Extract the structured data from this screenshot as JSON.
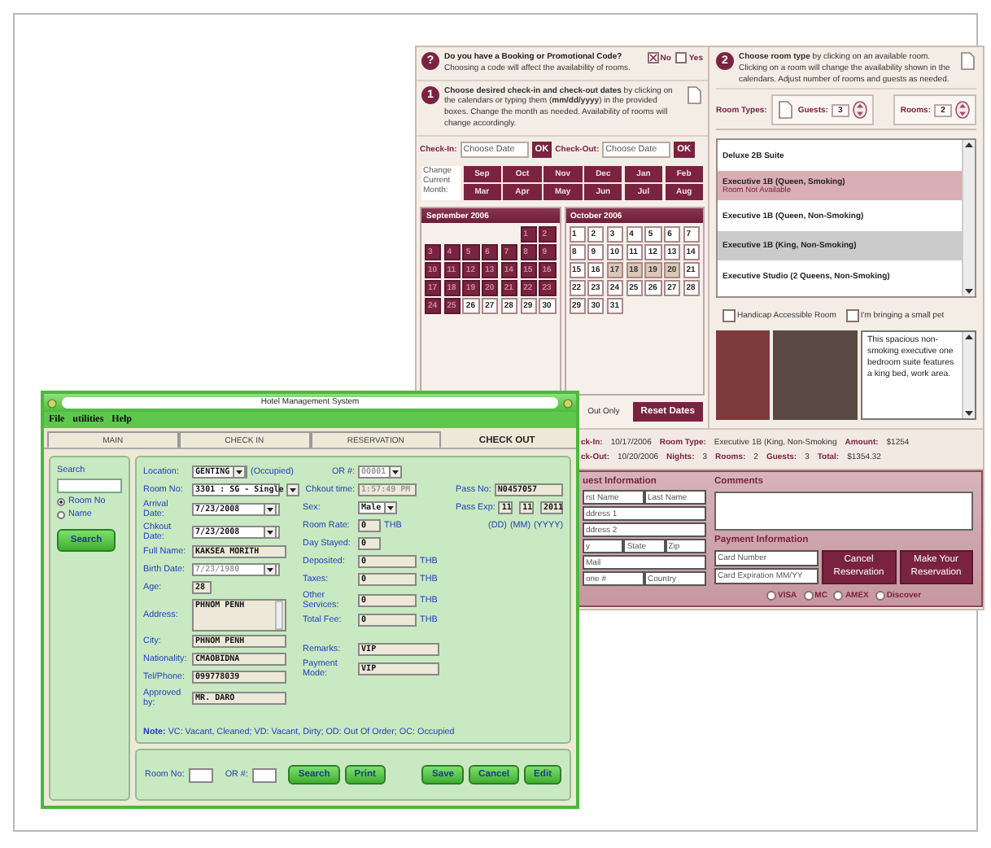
{
  "booking_window": {
    "promo": {
      "badge": "?",
      "title": "Do you have a Booking or Promotional Code?",
      "hint": "Choosing a code will affect the availability of rooms.",
      "options": [
        {
          "label": "No",
          "checked": true
        },
        {
          "label": "Yes",
          "checked": false
        }
      ]
    },
    "dates": {
      "badge": "1",
      "text": "**Choose desired check-in and check-out dates** by clicking on the calendars or typing them (**mm/dd/yyyy**) in the provided boxes. Change the month as needed. Availability of rooms will change accordingly.",
      "fields": [
        {
          "label": "Check-In:",
          "placeholder": "Choose Date",
          "button": "OK"
        },
        {
          "label": "Check-Out:",
          "placeholder": "Choose Date",
          "button": "OK"
        }
      ],
      "month_label": "Change Current Month:",
      "months": [
        "Sep",
        "Oct",
        "Nov",
        "Dec",
        "Jan",
        "Feb",
        "Mar",
        "Apr",
        "May",
        "Jun",
        "Jul",
        "Aug"
      ],
      "calendars": [
        {
          "title": "September 2006",
          "days": [
            {
              "kind": "empty"
            },
            {
              "kind": "empty"
            },
            {
              "kind": "empty"
            },
            {
              "kind": "empty"
            },
            {
              "kind": "empty"
            },
            {
              "day": "1",
              "kind": "blocked"
            },
            {
              "day": "2",
              "kind": "blocked"
            },
            {
              "day": "3",
              "kind": "blocked"
            },
            {
              "day": "4",
              "kind": "blocked"
            },
            {
              "day": "5",
              "kind": "blocked"
            },
            {
              "day": "6",
              "kind": "blocked"
            },
            {
              "day": "7",
              "kind": "blocked"
            },
            {
              "day": "8",
              "kind": "blocked"
            },
            {
              "day": "9",
              "kind": "blocked"
            },
            {
              "day": "10",
              "kind": "blocked"
            },
            {
              "day": "11",
              "kind": "blocked"
            },
            {
              "day": "12",
              "kind": "blocked"
            },
            {
              "day": "13",
              "kind": "blocked"
            },
            {
              "day": "14",
              "kind": "blocked"
            },
            {
              "day": "15",
              "kind": "blocked"
            },
            {
              "day": "16",
              "kind": "blocked"
            },
            {
              "day": "17",
              "kind": "blocked"
            },
            {
              "day": "18",
              "kind": "blocked"
            },
            {
              "day": "19",
              "kind": "blocked"
            },
            {
              "day": "20",
              "kind": "blocked"
            },
            {
              "day": "21",
              "kind": "blocked"
            },
            {
              "day": "22",
              "kind": "blocked"
            },
            {
              "day": "23",
              "kind": "blocked"
            },
            {
              "day": "24",
              "kind": "blocked"
            },
            {
              "day": "25",
              "kind": "blocked"
            },
            {
              "day": "26",
              "kind": "open"
            },
            {
              "day": "27",
              "kind": "open"
            },
            {
              "day": "28",
              "kind": "open"
            },
            {
              "day": "29",
              "kind": "open"
            },
            {
              "day": "30",
              "kind": "open"
            }
          ]
        },
        {
          "title": "October 2006",
          "days": [
            {
              "day": "1",
              "kind": "open"
            },
            {
              "day": "2",
              "kind": "open"
            },
            {
              "day": "3",
              "kind": "open"
            },
            {
              "day": "4",
              "kind": "open"
            },
            {
              "day": "5",
              "kind": "open"
            },
            {
              "day": "6",
              "kind": "open"
            },
            {
              "day": "7",
              "kind": "open"
            },
            {
              "day": "8",
              "kind": "open"
            },
            {
              "day": "9",
              "kind": "open"
            },
            {
              "day": "10",
              "kind": "open"
            },
            {
              "day": "11",
              "kind": "open"
            },
            {
              "day": "12",
              "kind": "open"
            },
            {
              "day": "13",
              "kind": "open"
            },
            {
              "day": "14",
              "kind": "open"
            },
            {
              "day": "15",
              "kind": "open"
            },
            {
              "day": "16",
              "kind": "open"
            },
            {
              "day": "17",
              "kind": "range"
            },
            {
              "day": "18",
              "kind": "range"
            },
            {
              "day": "19",
              "kind": "range"
            },
            {
              "day": "20",
              "kind": "range"
            },
            {
              "day": "21",
              "kind": "open"
            },
            {
              "day": "22",
              "kind": "open"
            },
            {
              "day": "23",
              "kind": "open"
            },
            {
              "day": "24",
              "kind": "open"
            },
            {
              "day": "25",
              "kind": "open"
            },
            {
              "day": "26",
              "kind": "open"
            },
            {
              "day": "27",
              "kind": "open"
            },
            {
              "day": "28",
              "kind": "open"
            },
            {
              "day": "29",
              "kind": "open"
            },
            {
              "day": "30",
              "kind": "open"
            },
            {
              "day": "31",
              "kind": "open"
            }
          ]
        }
      ],
      "footer_text": "Out Only",
      "reset_button": "Reset Dates"
    },
    "room": {
      "badge": "2",
      "text": "**Choose room type** by clicking on an available room. Clicking on a room will change the availability shown in the calendars. Adjust number of rooms and guests as needed.",
      "types_label": "Room Types:",
      "guests": {
        "label": "Guests:",
        "value": "3"
      },
      "rooms": {
        "label": "Rooms:",
        "value": "2"
      },
      "list": [
        {
          "name": "Deluxe 2B Suite",
          "kind": "available",
          "selected": false
        },
        {
          "name": "Executive 1B (Queen, Smoking)",
          "note": "Room Not Available",
          "kind": "unavailable",
          "selected": false
        },
        {
          "name": "Executive 1B (Queen, Non-Smoking)",
          "kind": "available",
          "selected": false
        },
        {
          "name": "Executive 1B (King, Non-Smoking)",
          "kind": "available",
          "selected": true
        },
        {
          "name": "Executive Studio (2 Queens, Non-Smoking)",
          "kind": "available",
          "selected": false
        }
      ],
      "options": [
        {
          "label": "Handicap Accessible Room",
          "checked": false
        },
        {
          "label": "I'm bringing a small pet",
          "checked": false
        }
      ],
      "description": "This spacious non-smoking executive one bedroom suite features a king bed, work area."
    },
    "summary": [
      [
        {
          "label": "ck-In:",
          "value": "10/17/2006"
        },
        {
          "label": "Room Type:",
          "value": "Executive 1B (King, Non-Smoking"
        },
        {
          "label": "Amount:",
          "value": "$1254"
        }
      ],
      [
        {
          "label": "ck-Out:",
          "value": "10/20/2006"
        },
        {
          "label": "Nights:",
          "value": "3"
        },
        {
          "label": "Rooms:",
          "value": "2"
        },
        {
          "label": "Guests:",
          "value": "3"
        },
        {
          "label": "Total:",
          "value": "$1354.32"
        }
      ]
    ],
    "guest": {
      "title": "uest Information",
      "rows": [
        [
          {
            "placeholder": "rst Name"
          },
          {
            "placeholder": "Last Name"
          }
        ],
        [
          {
            "placeholder": "ddress 1"
          }
        ],
        [
          {
            "placeholder": "ddress 2"
          }
        ],
        [
          {
            "placeholder": "y"
          },
          {
            "placeholder": "State"
          },
          {
            "placeholder": "Zip"
          }
        ],
        [
          {
            "placeholder": "Mail"
          }
        ],
        [
          {
            "placeholder": "one #"
          },
          {
            "placeholder": "Country"
          }
        ]
      ]
    },
    "comments": {
      "title": "Comments"
    },
    "payment": {
      "title": "Payment Information",
      "fields": [
        {
          "placeholder": "Card Number"
        },
        {
          "placeholder": "Card Expiration MM/YY"
        }
      ],
      "buttons": [
        "Cancel Reservation",
        "Make Your Reservation"
      ],
      "cards": [
        {
          "label": "VISA",
          "selected": false
        },
        {
          "label": "MC",
          "selected": false
        },
        {
          "label": "AMEX",
          "selected": false
        },
        {
          "label": "Discover",
          "selected": false
        }
      ]
    }
  },
  "hms_window": {
    "title": "Hotel Management System",
    "menu": [
      "File",
      "utilities",
      "Help"
    ],
    "tabs": [
      {
        "label": "MAIN",
        "selected": false
      },
      {
        "label": "CHECK IN",
        "selected": false
      },
      {
        "label": "RESERVATION",
        "selected": false
      },
      {
        "label": "CHECK OUT",
        "selected": true
      }
    ],
    "search": {
      "label": "Search",
      "options": [
        {
          "label": "Room No",
          "selected": true
        },
        {
          "label": "Name",
          "selected": false
        }
      ],
      "button": "Search"
    },
    "left_fields": [
      {
        "label": "Location:",
        "value": "GENTING",
        "kind": "select",
        "disabled": false,
        "after": "(Occupied)"
      },
      {
        "label": "Room No:",
        "value": "3301 : SG - Single",
        "kind": "select",
        "disabled": false
      },
      {
        "label": "Arrival Date:",
        "value": "7/23/2008",
        "kind": "select",
        "disabled": false
      },
      {
        "label": "Chkout Date:",
        "value": "7/23/2008",
        "kind": "select",
        "disabled": false
      },
      {
        "label": "Full Name:",
        "value": "KAKSEA MORITH",
        "kind": "text",
        "disabled": false
      },
      {
        "label": "Birth Date:",
        "value": "7/23/1980",
        "kind": "select",
        "disabled": true
      },
      {
        "label": "Age:",
        "value": "28",
        "kind": "short",
        "disabled": false
      },
      {
        "label": "Address:",
        "value": "PHNOM PENH",
        "kind": "area",
        "disabled": false
      },
      {
        "label": "City:",
        "value": "PHNOM PENH",
        "kind": "text",
        "disabled": false
      },
      {
        "label": "Nationality:",
        "value": "CMAOBIDNA",
        "kind": "text",
        "disabled": false
      },
      {
        "label": "Tel/Phone:",
        "value": "099778039",
        "kind": "text",
        "disabled": false
      },
      {
        "label": "Approved by:",
        "value": "MR. DARO",
        "kind": "text",
        "disabled": false
      }
    ],
    "middle_fields": [
      {
        "label": "OR #:",
        "value": "00001",
        "kind": "select",
        "disabled": true
      },
      {
        "label": "Chkout time:",
        "value": "1:57:49 PM",
        "kind": "text",
        "disabled": true
      },
      {
        "label": "Sex:",
        "value": "Male",
        "kind": "select",
        "disabled": false
      },
      {
        "label": "Room Rate:",
        "value": "0",
        "kind": "short",
        "disabled": false,
        "unit": "THB"
      },
      {
        "label": "Day Stayed:",
        "value": "0",
        "kind": "short",
        "disabled": false
      },
      {
        "label": "Deposited:",
        "value": "0",
        "kind": "text",
        "disabled": false,
        "unit": "THB"
      },
      {
        "label": "Taxes:",
        "value": "0",
        "kind": "text",
        "disabled": false,
        "unit": "THB"
      },
      {
        "label": "Other Services:",
        "value": "0",
        "kind": "text",
        "disabled": false,
        "unit": "THB"
      },
      {
        "label": "Total Fee:",
        "value": "0",
        "kind": "text",
        "disabled": false,
        "unit": "THB"
      },
      {
        "label": "Remarks:",
        "value": "VIP",
        "kind": "wide",
        "disabled": false
      },
      {
        "label": "Payment Mode:",
        "value": "VIP",
        "kind": "wide",
        "disabled": false
      }
    ],
    "passport": {
      "number_label": "Pass No:",
      "number": "N0457057",
      "expiry_label": "Pass Exp:",
      "expiry": [
        {
          "value": "11",
          "hint": "(DD)"
        },
        {
          "value": "11",
          "hint": "(MM)"
        },
        {
          "value": "2011",
          "hint": "(YYYY)"
        }
      ]
    },
    "note": "**Note:** VC: Vacant, Cleaned; VD: Vacant, Dirty; OD: Out Of Order; OC: Occupied",
    "bottom": {
      "fields": [
        "Room No:",
        "OR #:"
      ],
      "left_buttons": [
        "Search",
        "Print"
      ],
      "right_buttons": [
        "Save",
        "Cancel",
        "Edit"
      ]
    }
  }
}
